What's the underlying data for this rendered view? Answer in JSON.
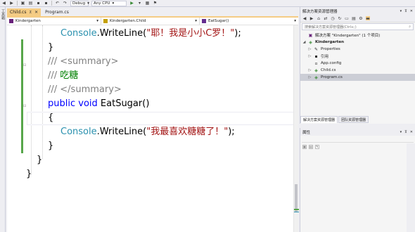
{
  "toolbar": {
    "config": "Debug",
    "platform": "Any CPU",
    "start_glyph": "▶"
  },
  "left_strip": {
    "toolbox_label": "工具箱"
  },
  "tabs": [
    {
      "label": "Child.cs",
      "active": true,
      "pin": "⊼",
      "close": "✕"
    },
    {
      "label": "Program.cs",
      "active": false
    }
  ],
  "navbar": {
    "project": "Kindergarten",
    "class": "Kindergarten.Child",
    "member": "EatSugar()"
  },
  "code": {
    "line1": {
      "type": "Console",
      "rest_a": ".WriteLine(",
      "str": "\"耶！我是小小C罗！\"",
      "rest_b": ");"
    },
    "line2": "}",
    "line3": {
      "a": "/// ",
      "b": "<summary>"
    },
    "line4": {
      "a": "/// ",
      "b": "吃糖"
    },
    "line5": {
      "a": "/// ",
      "b": "</summary>"
    },
    "line6": {
      "kw1": "public",
      "kw2": "void",
      "name": " EatSugar()"
    },
    "line7": "{",
    "line8": {
      "type": "Console",
      "rest_a": ".WriteLine(",
      "str": "\"我最喜欢糖糖了！\"",
      "rest_b": ");"
    },
    "line9": "}",
    "line10": "}",
    "line11": "}"
  },
  "solution_explorer": {
    "title": "解决方案资源管理器",
    "search_placeholder": "搜索解决方案资源管理器(Ctrl+;)",
    "items": [
      {
        "label": "解决方案 \"Kindergarten\" (1 个项目)",
        "icon": "solution-icon"
      },
      {
        "label": "Kindergarten",
        "icon": "csharp-project-icon",
        "bold": true
      },
      {
        "label": "Properties",
        "icon": "wrench-icon"
      },
      {
        "label": "引用",
        "icon": "references-icon"
      },
      {
        "label": "App.config",
        "icon": "config-file-icon"
      },
      {
        "label": "Child.cs",
        "icon": "csharp-file-icon"
      },
      {
        "label": "Program.cs",
        "icon": "csharp-file-icon",
        "selected": true
      }
    ],
    "bottom_tabs": [
      "解决方案资源管理器",
      "团队资源管理器"
    ]
  },
  "properties": {
    "title": "属性"
  },
  "colors": {
    "accent_tab": "#f5cc84",
    "keyword": "#0000ff",
    "type": "#2b91af",
    "string": "#a31515",
    "comment": "#008000",
    "change_bar": "#57a64a"
  }
}
